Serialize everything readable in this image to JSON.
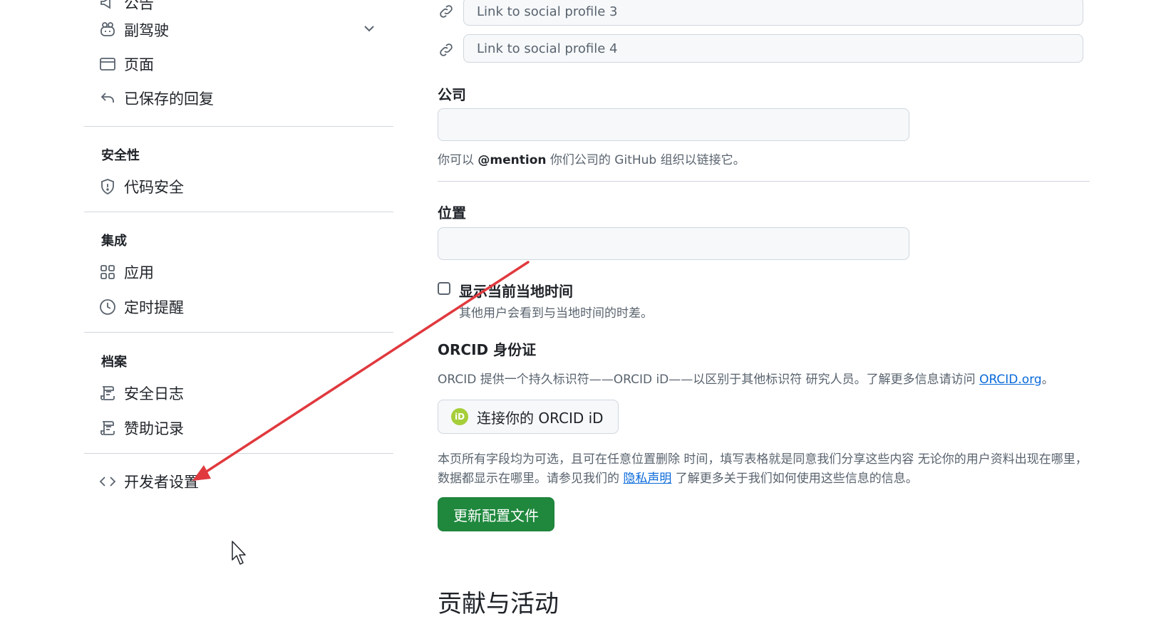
{
  "sidebar": {
    "partial_top_label": "公告",
    "copilot_label": "副驾驶",
    "pages_label": "页面",
    "saved_replies_label": "已保存的回复",
    "security_heading": "安全性",
    "code_security_label": "代码安全",
    "integrations_heading": "集成",
    "apps_label": "应用",
    "scheduled_reminders_label": "定时提醒",
    "archives_heading": "档案",
    "security_log_label": "安全日志",
    "sponsorship_log_label": "赞助记录",
    "developer_settings_label": "开发者设置"
  },
  "main": {
    "social3_placeholder": "Link to social profile 3",
    "social4_placeholder": "Link to social profile 4",
    "company_label": "公司",
    "company_note_pre": "你可以 ",
    "company_note_mention": "@mention",
    "company_note_post": " 你们公司的 GitHub 组织以链接它。",
    "location_label": "位置",
    "local_time_label": "显示当前当地时间",
    "local_time_note": "其他用户会看到与当地时间的时差。",
    "orcid_title": "ORCID 身份证",
    "orcid_desc": "ORCID 提供一个持久标识符——ORCID iD——以区别于其他标识符 研究人员。了解更多信息请访问 ",
    "orcid_link": "ORCID.org",
    "orcid_desc_end": "。",
    "orcid_badge": "iD",
    "orcid_button": "连接你的 ORCID iD",
    "privacy_pre": "本页所有字段均为可选，且可在任意位置删除 时间，填写表格就是同意我们分享这些内容 无论你的用户资料出现在哪里，数据都显示在哪里。请参见我们的 ",
    "privacy_link": "隐私声明",
    "privacy_post": " 了解更多关于我们如何使用这些信息的信息。",
    "update_button": "更新配置文件",
    "contributions_heading": "贡献与活动"
  },
  "colors": {
    "primary_button": "#1f883d",
    "link": "#0969da",
    "annotation_arrow": "#e0393e",
    "orcid_badge": "#a6ce39"
  }
}
